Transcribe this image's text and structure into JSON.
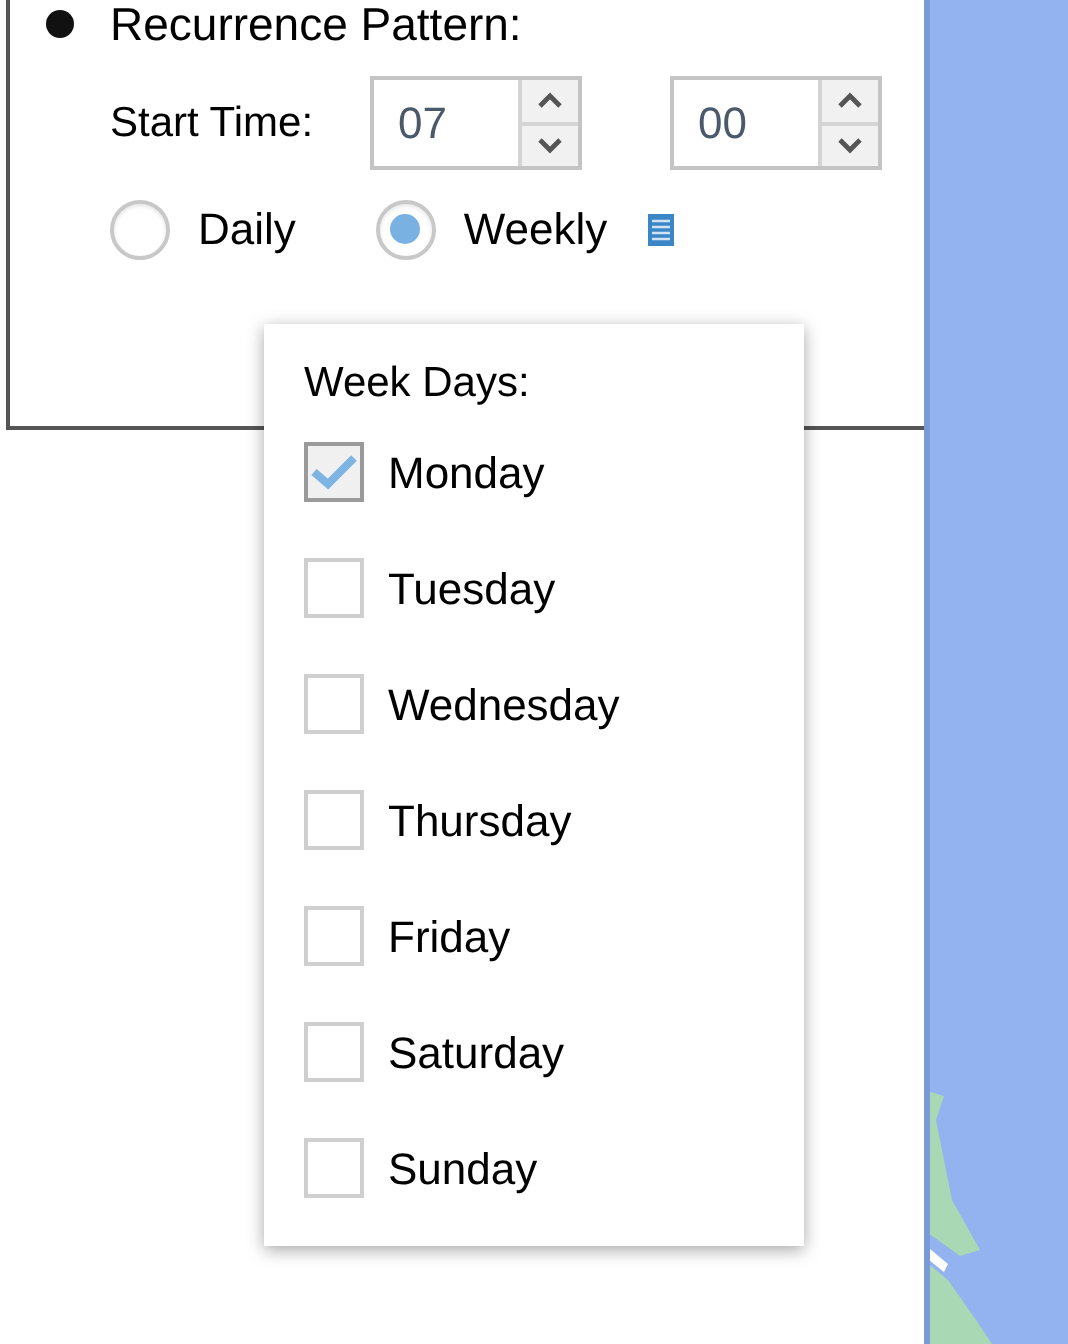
{
  "section": {
    "title": "Recurrence Pattern:"
  },
  "start_time": {
    "label": "Start Time:",
    "hour": "07",
    "minute": "00"
  },
  "frequency": [
    {
      "label": "Daily",
      "selected": false
    },
    {
      "label": "Weekly",
      "selected": true
    }
  ],
  "week_days": {
    "title": "Week Days:",
    "days": [
      {
        "label": "Monday",
        "checked": true
      },
      {
        "label": "Tuesday",
        "checked": false
      },
      {
        "label": "Wednesday",
        "checked": false
      },
      {
        "label": "Thursday",
        "checked": false
      },
      {
        "label": "Friday",
        "checked": false
      },
      {
        "label": "Saturday",
        "checked": false
      },
      {
        "label": "Sunday",
        "checked": false
      }
    ]
  }
}
